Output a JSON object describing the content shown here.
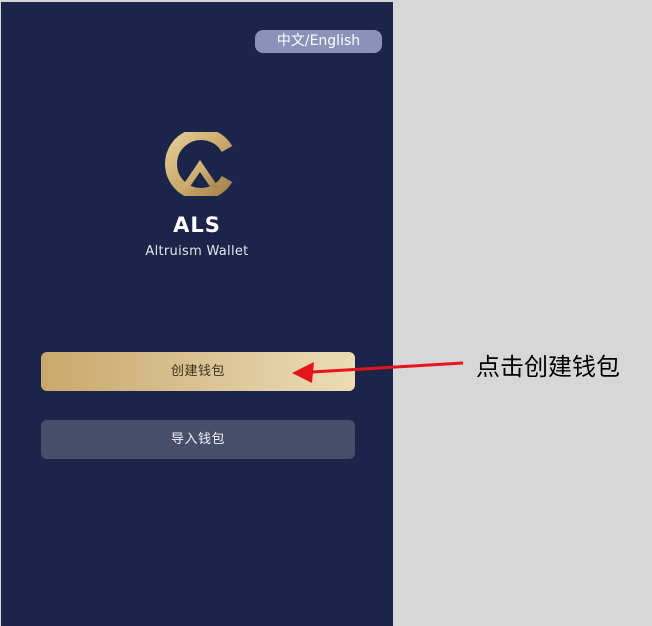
{
  "header": {
    "language_toggle_label": "中文/English"
  },
  "branding": {
    "logo_letters": "CA",
    "app_name": "ALS",
    "tagline": "Altruism Wallet"
  },
  "actions": {
    "create_wallet_label": "创建钱包",
    "import_wallet_label": "导入钱包"
  },
  "annotation": {
    "text": "点击创建钱包",
    "arrow_color": "#e8141b"
  },
  "colors": {
    "background": "#1b2449",
    "gold": "#c9a86b",
    "gold_light": "#ebdcb6",
    "toggle_bg": "#8b92b9",
    "secondary_button": "#474e69"
  }
}
